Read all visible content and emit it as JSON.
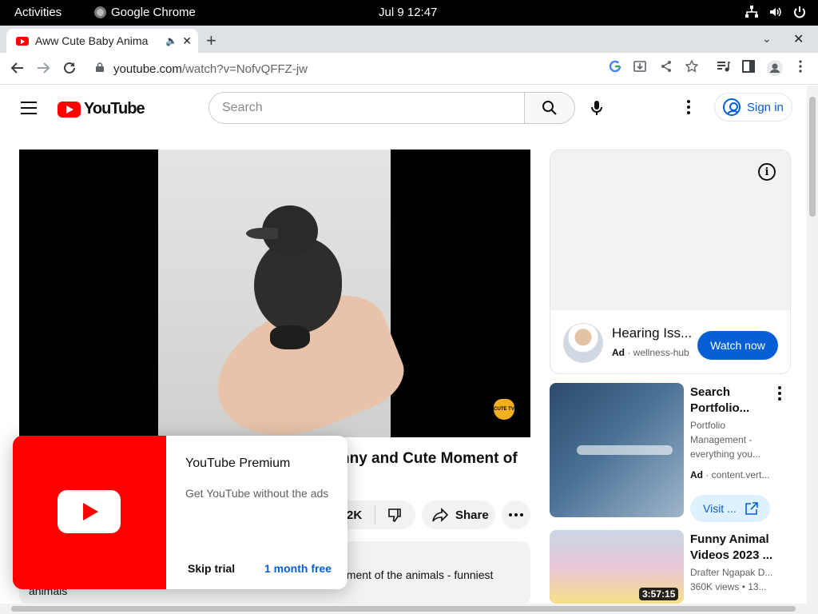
{
  "system_bar": {
    "activities": "Activities",
    "app_name": "Google Chrome",
    "clock": "Jul 9  12:47"
  },
  "browser": {
    "tab_title": "Aww Cute Baby Anima",
    "url_host": "youtube.com",
    "url_path": "/watch?v=NofvQFFZ-jw"
  },
  "youtube": {
    "logo_text": "YouTube",
    "search_placeholder": "Search",
    "sign_in": "Sign in"
  },
  "video": {
    "title_fragment": "nny and Cute Moment of",
    "like_count": "2K",
    "share_label": "Share",
    "description_fragment": "oment of the animals - funniest",
    "description_line2": "animals",
    "watermark": "CUTE TV"
  },
  "premium_popup": {
    "title": "YouTube Premium",
    "subtitle": "Get YouTube without the ads",
    "skip_label": "Skip trial",
    "trial_label": "1 month free"
  },
  "ad": {
    "title": "Hearing Iss...",
    "badge": "Ad",
    "advertiser": "wellness-hub",
    "cta": "Watch now"
  },
  "recommendations": [
    {
      "title": "Search Portfolio...",
      "line1": "Portfolio",
      "line2": "Management -",
      "line3": "everything you...",
      "badge": "Ad",
      "advertiser": "content.vert...",
      "cta": "Visit ..."
    },
    {
      "title": "Funny Animal Videos 2023 ...",
      "channel": "Drafter Ngapak D...",
      "views": "360K views",
      "age": "13...",
      "duration": "3:57:15"
    }
  ]
}
